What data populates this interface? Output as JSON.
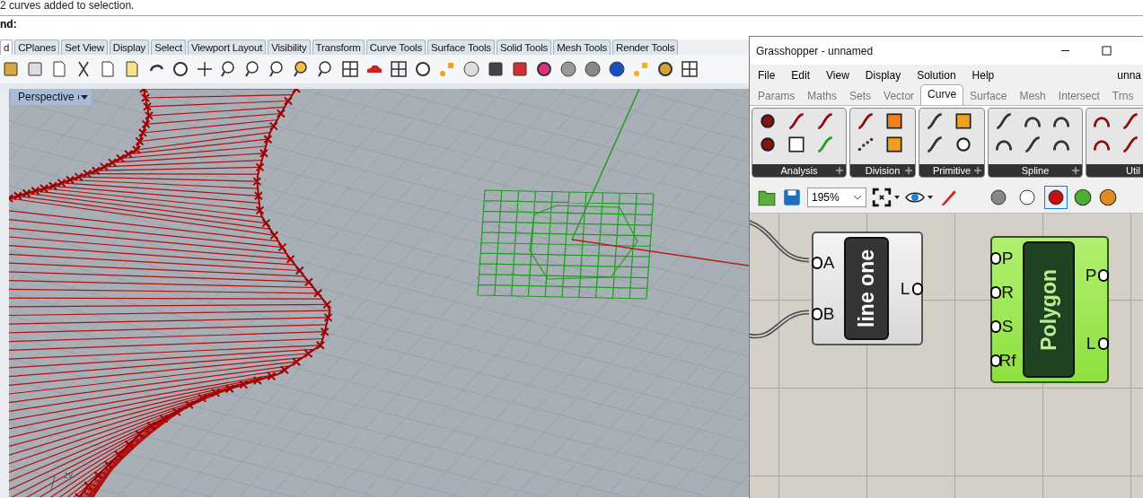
{
  "command_history": "2 curves added to selection.",
  "command_prompt": "nd:",
  "rhino_tabs": [
    {
      "label": "d",
      "selected": true
    },
    {
      "label": "CPlanes",
      "selected": false
    },
    {
      "label": "Set View",
      "selected": false
    },
    {
      "label": "Display",
      "selected": false
    },
    {
      "label": "Select",
      "selected": false
    },
    {
      "label": "Viewport Layout",
      "selected": false
    },
    {
      "label": "Visibility",
      "selected": false
    },
    {
      "label": "Transform",
      "selected": false
    },
    {
      "label": "Curve Tools",
      "selected": false
    },
    {
      "label": "Surface Tools",
      "selected": false
    },
    {
      "label": "Solid Tools",
      "selected": false
    },
    {
      "label": "Mesh Tools",
      "selected": false
    },
    {
      "label": "Render Tools",
      "selected": false
    }
  ],
  "viewport": {
    "title": "Perspective",
    "axis_label": "zy"
  },
  "grasshopper": {
    "title": "Grasshopper - unnamed",
    "menu": [
      "File",
      "Edit",
      "View",
      "Display",
      "Solution",
      "Help"
    ],
    "document_name": "unna",
    "tabs": [
      {
        "label": "Params",
        "selected": false
      },
      {
        "label": "Maths",
        "selected": false
      },
      {
        "label": "Sets",
        "selected": false
      },
      {
        "label": "Vector",
        "selected": false
      },
      {
        "label": "Curve",
        "selected": true
      },
      {
        "label": "Surface",
        "selected": false
      },
      {
        "label": "Mesh",
        "selected": false
      },
      {
        "label": "Intersect",
        "selected": false
      },
      {
        "label": "Trns",
        "selected": false
      }
    ],
    "panels": [
      {
        "label": "Analysis",
        "expandable": true
      },
      {
        "label": "Division",
        "expandable": true
      },
      {
        "label": "Primitive",
        "expandable": true
      },
      {
        "label": "Spline",
        "expandable": true
      },
      {
        "label": "Util"
      }
    ],
    "zoom": "195%",
    "preview_buttons": [
      {
        "selected": false
      },
      {
        "selected": false
      },
      {
        "selected": true
      }
    ],
    "components": [
      {
        "name": "line one",
        "inputs": [
          "A",
          "B"
        ],
        "outputs": [
          "L"
        ],
        "selected": false
      },
      {
        "name": "Polygon",
        "inputs": [
          "P",
          "R",
          "S",
          "Rf"
        ],
        "outputs": [
          "P",
          "L"
        ],
        "selected": true
      }
    ]
  }
}
